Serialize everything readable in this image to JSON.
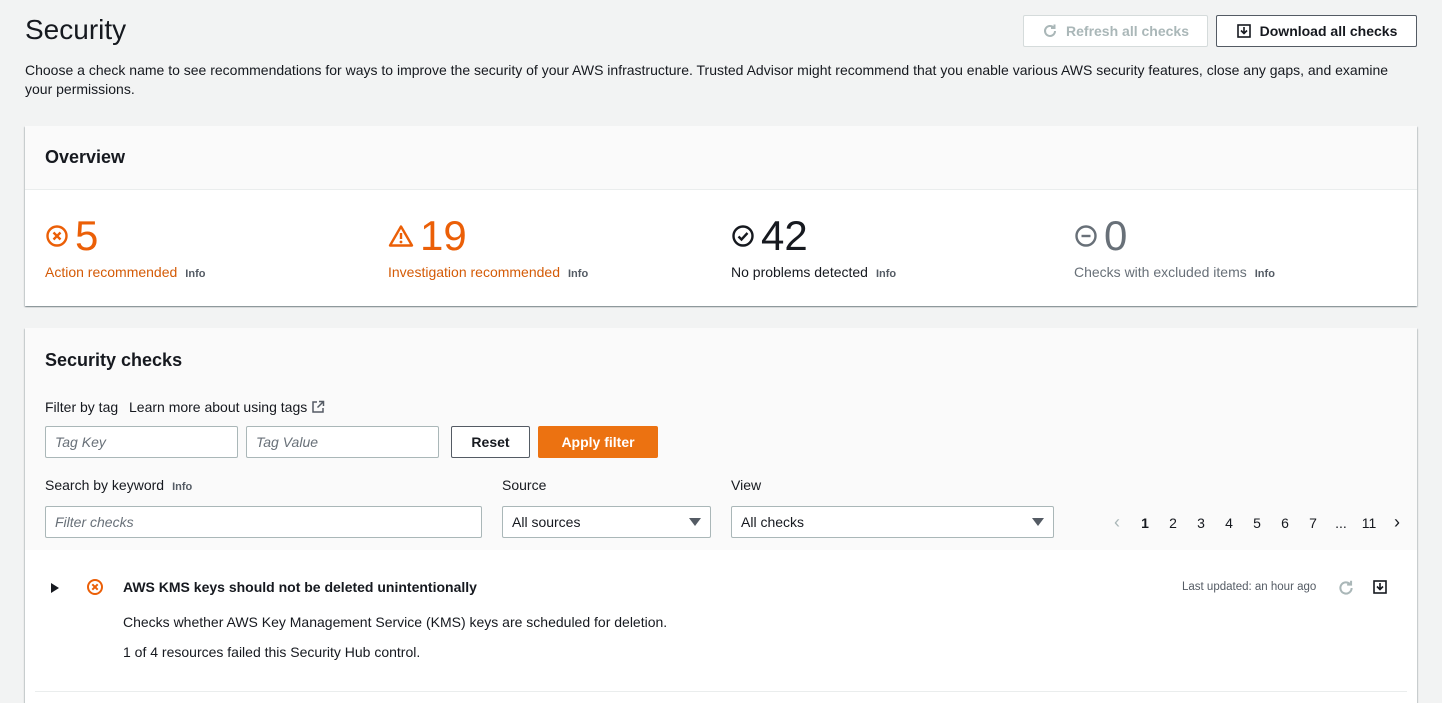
{
  "header": {
    "title": "Security",
    "description": "Choose a check name to see recommendations for ways to improve the security of your AWS infrastructure. Trusted Advisor might recommend that you enable various AWS security features, close any gaps, and examine your permissions.",
    "refresh_label": "Refresh all checks",
    "download_label": "Download all checks"
  },
  "overview": {
    "title": "Overview",
    "stats": [
      {
        "count": "5",
        "label": "Action recommended",
        "info": "Info",
        "icon": "x-circle-icon",
        "color": "#eb5f07"
      },
      {
        "count": "19",
        "label": "Investigation recommended",
        "info": "Info",
        "icon": "warning-triangle-icon",
        "color": "#eb5f07"
      },
      {
        "count": "42",
        "label": "No problems detected",
        "info": "Info",
        "icon": "check-circle-icon",
        "color": "#16191f"
      },
      {
        "count": "0",
        "label": "Checks with excluded items",
        "info": "Info",
        "icon": "minus-circle-icon",
        "color": "#687078"
      }
    ]
  },
  "checks": {
    "title": "Security checks",
    "filter_label": "Filter by tag",
    "learn_more": "Learn more about using tags",
    "tag_key_placeholder": "Tag Key",
    "tag_value_placeholder": "Tag Value",
    "reset_label": "Reset",
    "apply_label": "Apply filter",
    "search_label": "Search by keyword",
    "search_info": "Info",
    "search_placeholder": "Filter checks",
    "source_label": "Source",
    "source_value": "All sources",
    "view_label": "View",
    "view_value": "All checks",
    "pages": [
      "1",
      "2",
      "3",
      "4",
      "5",
      "6",
      "7",
      "...",
      "11"
    ],
    "current_page": "1",
    "rows": [
      {
        "title": "AWS KMS keys should not be deleted unintentionally",
        "description": "Checks whether AWS Key Management Service (KMS) keys are scheduled for deletion.",
        "result": "1 of 4 resources failed this Security Hub control.",
        "updated": "Last updated: an hour ago"
      }
    ]
  },
  "colors": {
    "accent": "#ec7211",
    "warning": "#eb5f07",
    "link": "#0073bb"
  }
}
